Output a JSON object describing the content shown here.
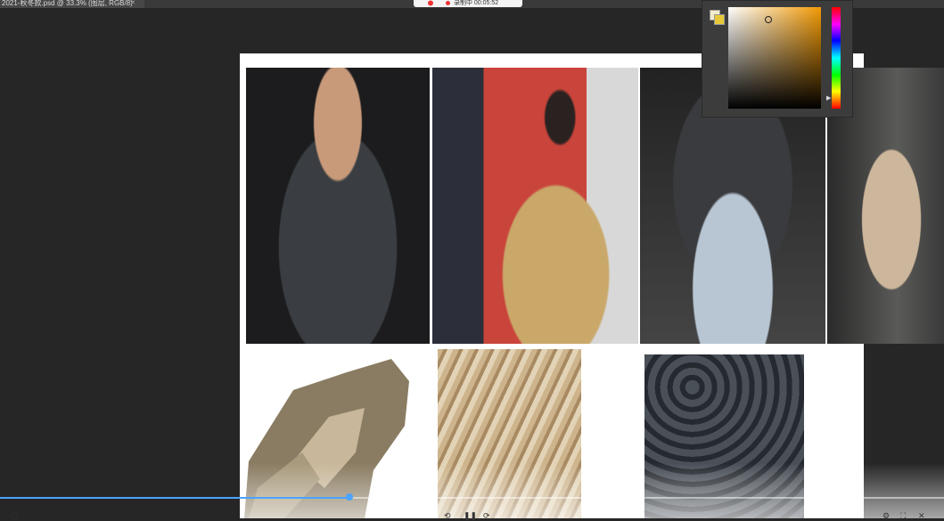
{
  "tab": {
    "title": "2021-秋冬款.psd @ 33.3% (图层, RGB/8)",
    "close_icon": "close-icon"
  },
  "recording": {
    "label": "录制中 00:05:52",
    "status_color": "#e33333"
  },
  "color_picker": {
    "foreground": "#e7c83a",
    "background": "#f2eccd",
    "hue_base": "#f29a05"
  },
  "video": {
    "progress_percent": 37
  },
  "photos": [
    "black-feather-dress",
    "gold-feather-cape",
    "grey-wing-gown",
    "beige-feather-runway",
    "wing-sketch",
    "gold-feather-closeup",
    "dark-feather-closeup"
  ]
}
